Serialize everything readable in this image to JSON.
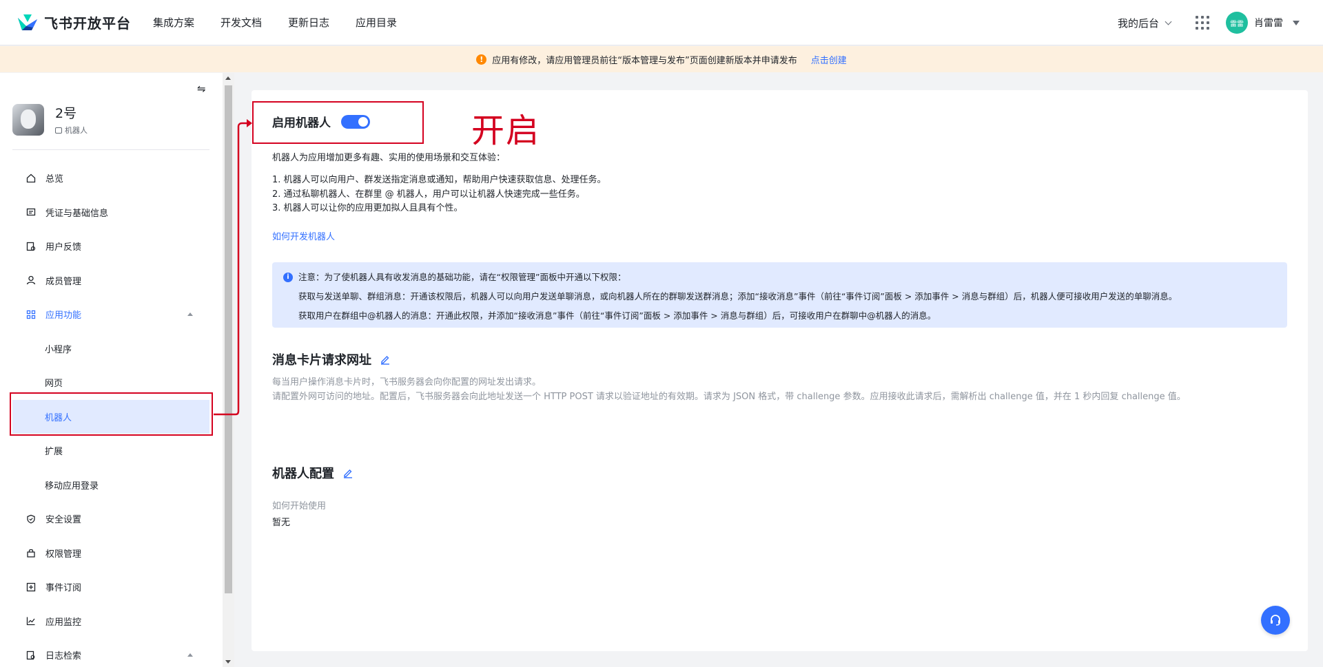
{
  "topnav": {
    "brand": "飞书开放平台",
    "links": [
      "集成方案",
      "开发文档",
      "更新日志",
      "应用目录"
    ],
    "backend_label": "我的后台",
    "avatar_text": "雷雷",
    "username": "肖雷雷"
  },
  "banner": {
    "text": "应用有修改，请应用管理员前往“版本管理与发布”页面创建新版本并申请发布",
    "link": "点击创建"
  },
  "sidebar": {
    "app_name": "2号",
    "app_tag": "机器人",
    "items": [
      {
        "label": "总览"
      },
      {
        "label": "凭证与基础信息"
      },
      {
        "label": "用户反馈"
      },
      {
        "label": "成员管理"
      },
      {
        "label": "应用功能"
      },
      {
        "label": "小程序"
      },
      {
        "label": "网页"
      },
      {
        "label": "机器人"
      },
      {
        "label": "扩展"
      },
      {
        "label": "移动应用登录"
      },
      {
        "label": "安全设置"
      },
      {
        "label": "权限管理"
      },
      {
        "label": "事件订阅"
      },
      {
        "label": "应用监控"
      },
      {
        "label": "日志检索"
      }
    ]
  },
  "main": {
    "enable_title": "启用机器人",
    "annotation": "开启",
    "intro": "机器人为应用增加更多有趣、实用的使用场景和交互体验：",
    "list": [
      "1. 机器人可以向用户、群发送指定消息或通知，帮助用户快速获取信息、处理任务。",
      "2. 通过私聊机器人、在群里 @ 机器人，用户可以让机器人快速完成一些任务。",
      "3. 机器人可以让你的应用更加拟人且具有个性。"
    ],
    "how_link": "如何开发机器人",
    "notice": {
      "title": "注意：为了使机器人具有收发消息的基础功能，请在“权限管理”面板中开通以下权限：",
      "line1": "获取与发送单聊、群组消息：开通该权限后，机器人可以向用户发送单聊消息，或向机器人所在的群聊发送群消息；添加“接收消息”事件（前往“事件订阅”面板 > 添加事件 > 消息与群组）后，机器人便可接收用户发送的单聊消息。",
      "line2": "获取用户在群组中@机器人的消息：开通此权限，并添加“接收消息”事件（前往“事件订阅”面板 > 添加事件 > 消息与群组）后，可接收用户在群聊中@机器人的消息。"
    },
    "card_section": {
      "title": "消息卡片请求网址",
      "desc1": "每当用户操作消息卡片时，飞书服务器会向你配置的网址发出请求。",
      "desc2": "请配置外网可访问的地址。配置后，飞书服务器会向此地址发送一个 HTTP POST 请求以验证地址的有效期。请求为 JSON 格式，带 challenge 参数。应用接收此请求后，需解析出 challenge 值，并在 1 秒内回复 challenge 值。"
    },
    "config_section": {
      "title": "机器人配置",
      "label": "如何开始使用",
      "value": "暂无"
    }
  },
  "colors": {
    "accent": "#3370ff",
    "annotation": "#d4001f",
    "banner_bg": "#fdf0df",
    "active_bg": "#e1eaff"
  }
}
